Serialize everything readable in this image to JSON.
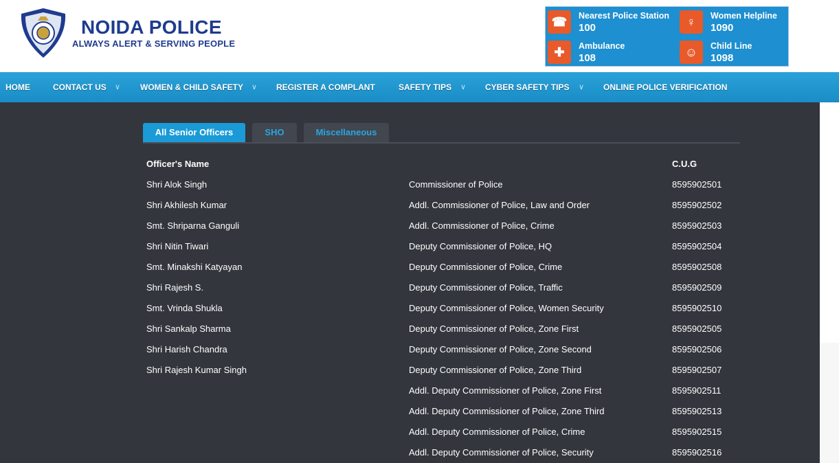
{
  "brand": {
    "title": "NOIDA POLICE",
    "tagline": "ALWAYS ALERT & SERVING PEOPLE",
    "logo_icon": "police-emblem-icon"
  },
  "helplines": [
    {
      "label": "Nearest Police Station",
      "number": "100",
      "icon": "phone-icon"
    },
    {
      "label": "Women Helpline",
      "number": "1090",
      "icon": "woman-icon"
    },
    {
      "label": "Ambulance",
      "number": "108",
      "icon": "medical-cross-icon"
    },
    {
      "label": "Child Line",
      "number": "1098",
      "icon": "child-icon"
    }
  ],
  "nav": [
    {
      "label": "HOME",
      "dropdown": false
    },
    {
      "label": "CONTACT US",
      "dropdown": true
    },
    {
      "label": "WOMEN & CHILD SAFETY",
      "dropdown": true
    },
    {
      "label": "REGISTER A COMPLANT",
      "dropdown": false
    },
    {
      "label": "SAFETY TIPS",
      "dropdown": true
    },
    {
      "label": "CYBER SAFETY TIPS",
      "dropdown": true
    },
    {
      "label": "ONLINE POLICE VERIFICATION",
      "dropdown": false
    }
  ],
  "tabs": [
    {
      "label": "All Senior Officers",
      "active": true
    },
    {
      "label": "SHO",
      "active": false
    },
    {
      "label": "Miscellaneous",
      "active": false
    }
  ],
  "table": {
    "headers": [
      "Officer's Name",
      "",
      "C.U.G"
    ],
    "rows": [
      [
        "Shri Alok Singh",
        "Commissioner of Police",
        "8595902501"
      ],
      [
        "Shri Akhilesh Kumar",
        "Addl. Commissioner of Police, Law and Order",
        "8595902502"
      ],
      [
        "Smt. Shriparna Ganguli",
        "Addl. Commissioner of Police, Crime",
        "8595902503"
      ],
      [
        "Shri Nitin Tiwari",
        "Deputy Commissioner of Police, HQ",
        "8595902504"
      ],
      [
        "Smt. Minakshi Katyayan",
        "Deputy Commissioner of Police, Crime",
        "8595902508"
      ],
      [
        "Shri Rajesh S.",
        "Deputy Commissioner of Police, Traffic",
        "8595902509"
      ],
      [
        "Smt. Vrinda Shukla",
        "Deputy Commissioner of Police, Women Security",
        "8595902510"
      ],
      [
        "Shri Sankalp Sharma",
        "Deputy Commissioner of Police, Zone First",
        "8595902505"
      ],
      [
        "Shri Harish Chandra",
        "Deputy Commissioner of Police, Zone Second",
        "8595902506"
      ],
      [
        "Shri Rajesh Kumar Singh",
        "Deputy Commissioner of Police, Zone Third",
        "8595902507"
      ],
      [
        "",
        "Addl. Deputy Commissioner of Police, Zone First",
        "8595902511"
      ],
      [
        "",
        "Addl. Deputy Commissioner of Police, Zone Third",
        "8595902513"
      ],
      [
        "",
        "Addl. Deputy Commissioner of Police, Crime",
        "8595902515"
      ],
      [
        "",
        "Addl. Deputy Commissioner of Police, Security",
        "8595902516"
      ]
    ]
  },
  "colors": {
    "brand_blue": "#1f3b8f",
    "nav_blue": "#1a8cc6",
    "tab_active": "#1a9ad6",
    "content_bg": "#33363d",
    "helpline_icon": "#e85a2a"
  }
}
